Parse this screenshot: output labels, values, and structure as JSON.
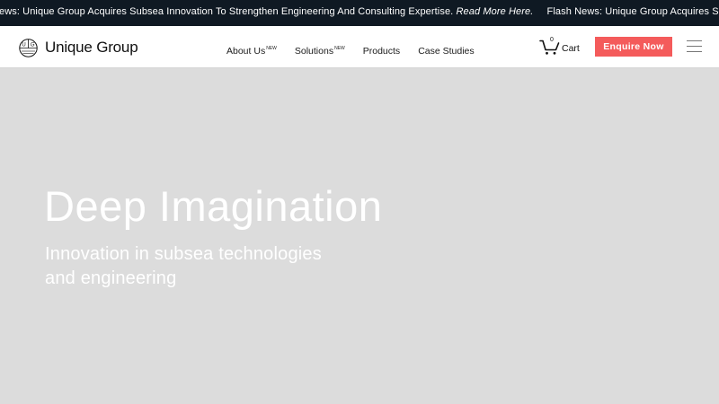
{
  "ticker": {
    "items": [
      {
        "text": "ews: Unique Group Acquires Subsea Innovation To Strengthen Engineering And Consulting Expertise.",
        "link": "Read More Here."
      },
      {
        "text": "Flash News: Unique Group Acquires Subsea Innovatio",
        "link": ""
      }
    ],
    "background": "#0f1923"
  },
  "header": {
    "brand": "Unique Group",
    "logo_letters": [
      "U",
      "G"
    ],
    "nav": [
      {
        "label": "About Us",
        "badge": "NEW"
      },
      {
        "label": "Solutions",
        "badge": "NEW"
      },
      {
        "label": "Products",
        "badge": ""
      },
      {
        "label": "Case Studies",
        "badge": ""
      }
    ],
    "cart": {
      "count": "0",
      "label": "Cart",
      "icon": "cart-icon"
    },
    "cta": {
      "label": "Enquire Now",
      "color": "#f45b5b"
    },
    "menu_icon": "hamburger-icon"
  },
  "hero": {
    "title": "Deep Imagination",
    "subtitle": "Innovation in subsea technologies and engineering",
    "background": "#dcdcdc"
  }
}
